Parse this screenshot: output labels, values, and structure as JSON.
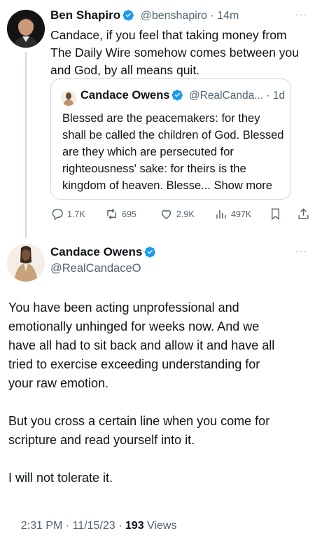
{
  "tweet1": {
    "author_name": "Ben Shapiro",
    "handle": "@benshapiro",
    "time": "14m",
    "text_lines": [
      "Candace, if you feel that taking money from",
      "The Daily Wire somehow comes between you",
      "and God, by all means quit."
    ],
    "quote": {
      "author_name": "Candace Owens",
      "handle": "@RealCanda...",
      "time": "1d",
      "text_lines": [
        "Blessed are the peacemakers: for they",
        "shall be called the children of God. Blessed",
        "are they which are persecuted for",
        "righteousness' sake: for theirs is the",
        "kingdom of heaven. Blesse..."
      ],
      "show_more": "Show more"
    },
    "actions": {
      "replies": "1.7K",
      "retweets": "695",
      "likes": "2.9K",
      "views": "497K"
    }
  },
  "tweet2": {
    "author_name": "Candace Owens",
    "handle": "@RealCandaceO",
    "paragraphs": [
      [
        "You have been acting unprofessional and",
        "emotionally unhinged  for weeks now. And we",
        "have all had to sit back and allow it and have all",
        "tried to exercise exceeding understanding for",
        "your raw emotion."
      ],
      [
        "But you cross a certain line when you come for",
        "scripture and read yourself into it."
      ],
      [
        "I will not tolerate it."
      ]
    ],
    "timestamp": "2:31 PM · 11/15/23 · ",
    "views_count": "193",
    "views_label": " Views"
  },
  "colors": {
    "verified_blue": "#1d9bf0",
    "muted": "#536471",
    "border": "#cfd9de",
    "text": "#0f1419"
  },
  "icons": [
    "verified-badge-icon",
    "more-icon",
    "reply-icon",
    "retweet-icon",
    "like-icon",
    "views-icon",
    "bookmark-icon",
    "share-icon"
  ]
}
